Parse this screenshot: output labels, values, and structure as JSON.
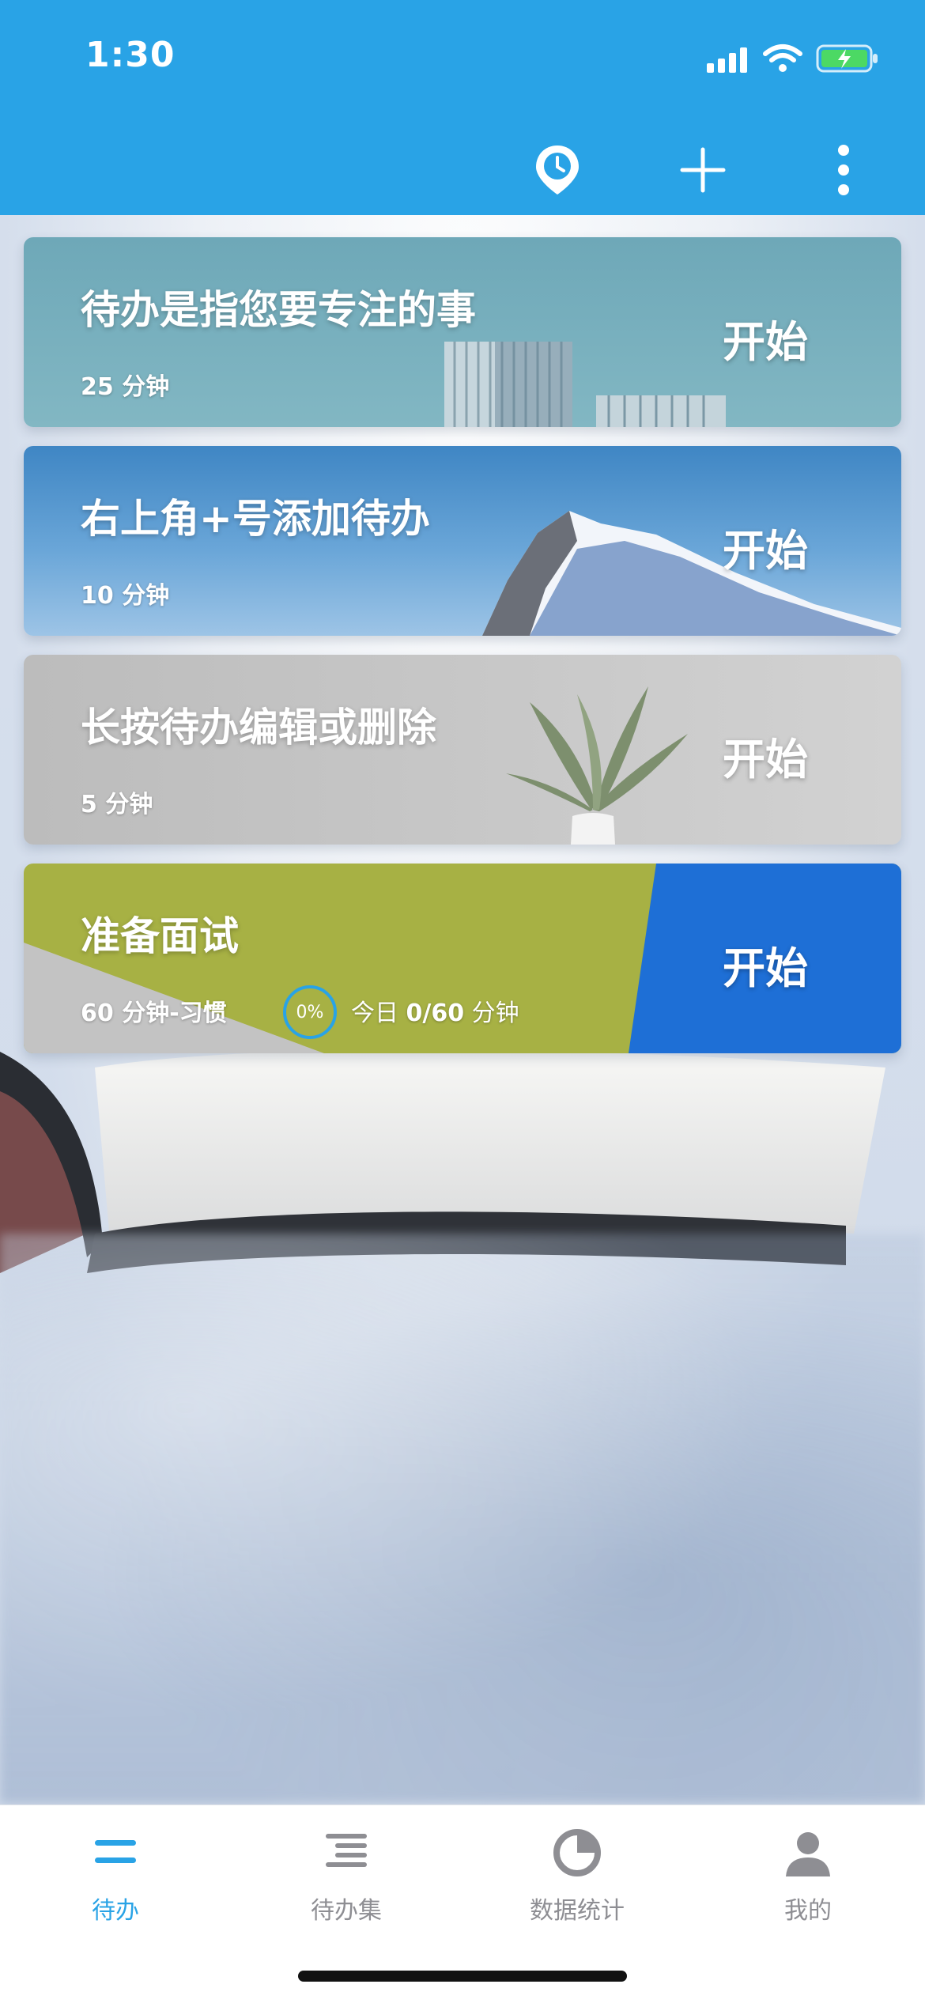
{
  "status_bar": {
    "time": "1:30"
  },
  "toolbar": {
    "icons": [
      "location-clock-icon",
      "add-icon",
      "more-vertical-icon"
    ]
  },
  "todos": [
    {
      "title": "待办是指您要专注的事",
      "duration": "25 分钟",
      "action": "开始",
      "theme": "buildings"
    },
    {
      "title": "右上角+号添加待办",
      "duration": "10 分钟",
      "action": "开始",
      "theme": "mountain"
    },
    {
      "title": "长按待办编辑或删除",
      "duration": "5 分钟",
      "action": "开始",
      "theme": "plant"
    },
    {
      "title": "准备面试",
      "duration": "60 分钟-习惯",
      "progress": "0%",
      "today_prefix": "今日 ",
      "today_value": "0/60",
      "today_suffix": " 分钟",
      "action": "开始",
      "theme": "paper"
    }
  ],
  "tabs": [
    {
      "label": "待办",
      "icon": "list-icon",
      "active": true
    },
    {
      "label": "待办集",
      "icon": "list-group-icon",
      "active": false
    },
    {
      "label": "数据统计",
      "icon": "pie-chart-icon",
      "active": false
    },
    {
      "label": "我的",
      "icon": "user-icon",
      "active": false
    }
  ],
  "colors": {
    "primary": "#29a3e6",
    "tab_inactive": "#8e8e93",
    "battery": "#4cd964"
  }
}
